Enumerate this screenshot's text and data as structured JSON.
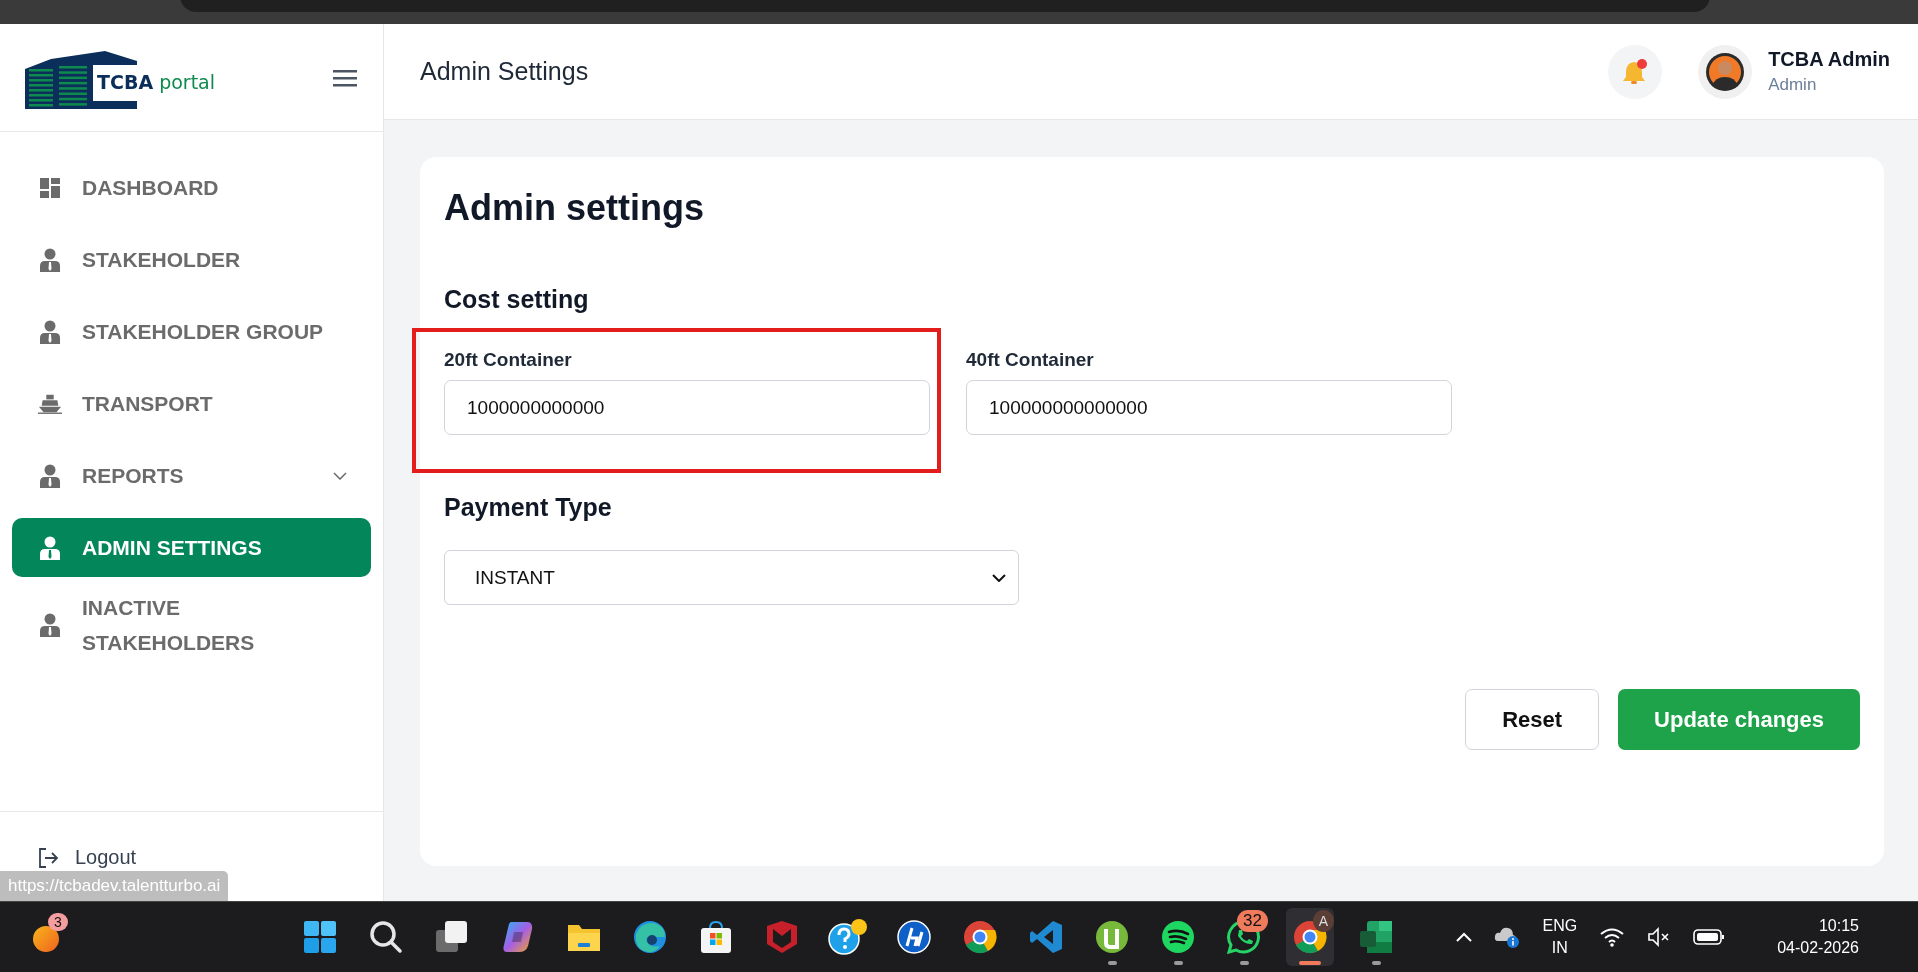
{
  "logo": {
    "brand": "TCBA",
    "product": "portal"
  },
  "sidebar": {
    "items": [
      {
        "label": "DASHBOARD",
        "kind": "dashboard",
        "selected": false,
        "expandable": false
      },
      {
        "label": "STAKEHOLDER",
        "kind": "person",
        "selected": false,
        "expandable": false
      },
      {
        "label": "STAKEHOLDER GROUP",
        "kind": "person",
        "selected": false,
        "expandable": false
      },
      {
        "label": "TRANSPORT",
        "kind": "ship",
        "selected": false,
        "expandable": false
      },
      {
        "label": "REPORTS",
        "kind": "person",
        "selected": false,
        "expandable": true
      },
      {
        "label": "ADMIN SETTINGS",
        "kind": "person",
        "selected": true,
        "expandable": false
      },
      {
        "label": "INACTIVE STAKEHOLDERS",
        "kind": "person",
        "selected": false,
        "expandable": false
      }
    ],
    "logout": "Logout"
  },
  "header": {
    "title": "Admin Settings",
    "notification": {
      "unread": true
    },
    "user": {
      "name": "TCBA Admin",
      "role": "Admin"
    }
  },
  "settings": {
    "title": "Admin settings",
    "cost_section": "Cost setting",
    "cost_fields": [
      {
        "label": "20ft Container",
        "value": "1000000000000",
        "highlighted": true
      },
      {
        "label": "40ft Container",
        "value": "100000000000000",
        "highlighted": false
      }
    ],
    "payment_section": "Payment Type",
    "payment_type": "INSTANT",
    "buttons": [
      {
        "label": "Reset",
        "kind": "secondary"
      },
      {
        "label": "Update changes",
        "kind": "primary"
      }
    ]
  },
  "status_url": "https://tcbadev.talentturbo.ai",
  "taskbar": {
    "widgets_badge": "3",
    "apps": [
      {
        "kind": "start",
        "running": false,
        "active": false
      },
      {
        "kind": "search",
        "running": false,
        "active": false
      },
      {
        "kind": "taskview",
        "running": false,
        "active": false
      },
      {
        "kind": "assistant",
        "running": false,
        "active": false
      },
      {
        "kind": "folder",
        "running": false,
        "active": false
      },
      {
        "kind": "edge",
        "running": false,
        "active": false
      },
      {
        "kind": "store",
        "running": false,
        "active": false
      },
      {
        "kind": "shield",
        "running": false,
        "active": false
      },
      {
        "kind": "help",
        "running": false,
        "active": false,
        "notice": true
      },
      {
        "kind": "logo",
        "running": false,
        "active": false
      },
      {
        "kind": "browser",
        "running": false,
        "active": false
      },
      {
        "kind": "code",
        "running": false,
        "active": false
      },
      {
        "kind": "torrent",
        "running": true,
        "active": false
      },
      {
        "kind": "music",
        "running": true,
        "active": false
      },
      {
        "kind": "chat",
        "running": true,
        "active": false,
        "badge": "32"
      },
      {
        "kind": "browser",
        "running": true,
        "active": true,
        "badge": "A"
      },
      {
        "kind": "sheet",
        "running": true,
        "active": false
      }
    ],
    "tray": {
      "language": "ENG",
      "region": "IN",
      "time": "10:15",
      "date": "04-02-2026"
    }
  }
}
